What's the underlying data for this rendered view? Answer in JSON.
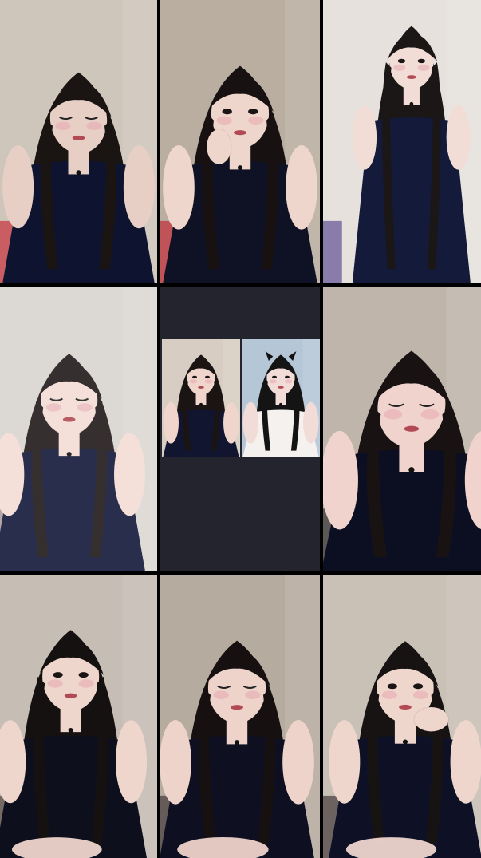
{
  "layout": "3x3-live-video-grid",
  "tiles": [
    {
      "id": "tile-1",
      "content": "video-feed",
      "bg": "#cfc6bb",
      "skin": "#e8cfc6",
      "hair": "#1a1412",
      "dress": "#0e1330",
      "accent": "#c83a44",
      "pose": "head-down"
    },
    {
      "id": "tile-2",
      "content": "video-feed",
      "bg": "#b9aea0",
      "skin": "#efd6cc",
      "hair": "#171111",
      "dress": "#0f1124",
      "accent": "#c33440",
      "pose": "hand-chin"
    },
    {
      "id": "tile-3",
      "content": "video-feed",
      "bg": "#e6e1dc",
      "skin": "#f1ddd6",
      "hair": "#1b1716",
      "dress": "#141a3a",
      "accent": "#6a5a9a",
      "pose": "standing"
    },
    {
      "id": "tile-4",
      "content": "video-feed",
      "bg": "#d9d4cf",
      "skin": "#f3dcd5",
      "hair": "#201818",
      "dress": "#111739",
      "accent": "#9a8b86",
      "pose": "blurred"
    },
    {
      "id": "tile-5",
      "content": "pip-pair",
      "bg": "#23242e",
      "left": {
        "bg": "#d7cdc2",
        "skin": "#efd5cc",
        "hair": "#1a1412",
        "dress": "#121530"
      },
      "right": {
        "bg": "#b5c7d6",
        "skin": "#f1dcd8",
        "hair": "#141414",
        "dress": "#f4f1ee"
      }
    },
    {
      "id": "tile-6",
      "content": "video-feed",
      "bg": "#bfb5ab",
      "skin": "#f0d3cc",
      "hair": "#181212",
      "dress": "#0c0f22",
      "accent": "#3a3a3a",
      "pose": "head-down-close"
    },
    {
      "id": "tile-7",
      "content": "video-feed",
      "bg": "#c6bdb4",
      "skin": "#efd6cc",
      "hair": "#161111",
      "dress": "#0d0f1d",
      "accent": "#5a4e4a",
      "pose": "smile"
    },
    {
      "id": "tile-8",
      "content": "video-feed",
      "bg": "#b6ab9f",
      "skin": "#eed3ca",
      "hair": "#161010",
      "dress": "#0e1022",
      "accent": "#4a4040",
      "pose": "eyes-closed"
    },
    {
      "id": "tile-9",
      "content": "video-feed",
      "bg": "#c9c0b6",
      "skin": "#efd6cd",
      "hair": "#181313",
      "dress": "#0e1125",
      "accent": "#4c4444",
      "pose": "hand-chin-right"
    }
  ]
}
